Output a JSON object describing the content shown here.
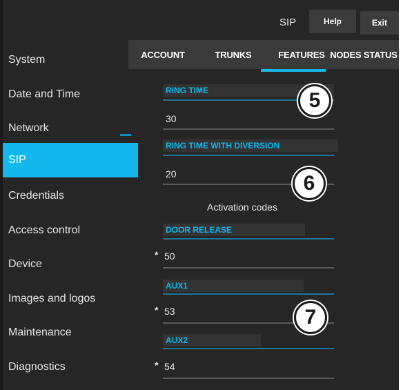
{
  "header": {
    "section_label": "SIP",
    "help_label": "Help",
    "exit_label": "Exit"
  },
  "sidebar": {
    "items": [
      {
        "label": "System"
      },
      {
        "label": "Date and Time"
      },
      {
        "label": "Network"
      },
      {
        "label": "SIP",
        "active": true
      },
      {
        "label": "Credentials"
      },
      {
        "label": "Access control"
      },
      {
        "label": "Device"
      },
      {
        "label": "Images and logos"
      },
      {
        "label": "Maintenance"
      },
      {
        "label": "Diagnostics"
      }
    ]
  },
  "tabs": {
    "account": "ACCOUNT",
    "trunks": "TRUNKS",
    "features": "FEATURES",
    "nodes_status": "NODES STATUS",
    "active": "FEATURES"
  },
  "fields": {
    "ring_time": {
      "label": "RING TIME",
      "value": "30"
    },
    "ring_time_diversion": {
      "label": "RING TIME WITH DIVERSION",
      "value": "20"
    },
    "section_title": "Activation codes",
    "door_release": {
      "label": "DOOR RELEASE",
      "prefix": "*",
      "value": "50"
    },
    "aux1": {
      "label": "AUX1",
      "prefix": "*",
      "value": "53"
    },
    "aux2": {
      "label": "AUX2",
      "prefix": "*",
      "value": "54"
    }
  },
  "callouts": [
    "5",
    "6",
    "7"
  ],
  "colors": {
    "accent": "#12b7ee",
    "background": "#262626",
    "tab_bar": "#3a3a3a",
    "button": "#3c3c3c"
  }
}
